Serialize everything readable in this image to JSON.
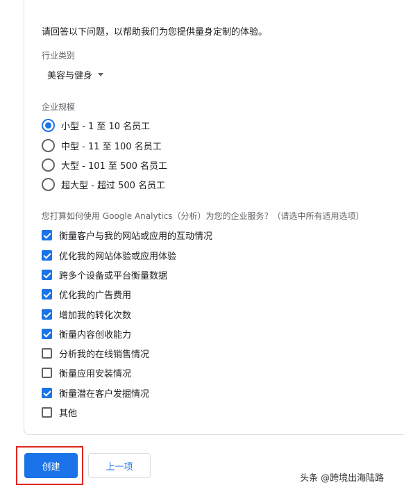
{
  "intro": "请回答以下问题，以帮助我们为您提供量身定制的体验。",
  "industry": {
    "label": "行业类别",
    "selected": "美容与健身"
  },
  "business_size": {
    "label": "企业规模",
    "options": [
      {
        "label": "小型 - 1 至 10 名员工",
        "selected": true
      },
      {
        "label": "中型 - 11 至 100 名员工",
        "selected": false
      },
      {
        "label": "大型 - 101 至 500 名员工",
        "selected": false
      },
      {
        "label": "超大型 - 超过 500 名员工",
        "selected": false
      }
    ]
  },
  "usage": {
    "label": "您打算如何使用 Google Analytics（分析）为您的企业服务？（请选中所有适用选项）",
    "options": [
      {
        "label": "衡量客户与我的网站或应用的互动情况",
        "checked": true
      },
      {
        "label": "优化我的网站体验或应用体验",
        "checked": true
      },
      {
        "label": "跨多个设备或平台衡量数据",
        "checked": true
      },
      {
        "label": "优化我的广告费用",
        "checked": true
      },
      {
        "label": "增加我的转化次数",
        "checked": true
      },
      {
        "label": "衡量内容创收能力",
        "checked": true
      },
      {
        "label": "分析我的在线销售情况",
        "checked": false
      },
      {
        "label": "衡量应用安装情况",
        "checked": false
      },
      {
        "label": "衡量潜在客户发掘情况",
        "checked": true
      },
      {
        "label": "其他",
        "checked": false
      }
    ]
  },
  "buttons": {
    "create": "创建",
    "previous": "上一项"
  },
  "watermark": "头条 @跨境出海陆路",
  "colors": {
    "accent": "#1a73e8",
    "highlight": "#e0261f"
  }
}
